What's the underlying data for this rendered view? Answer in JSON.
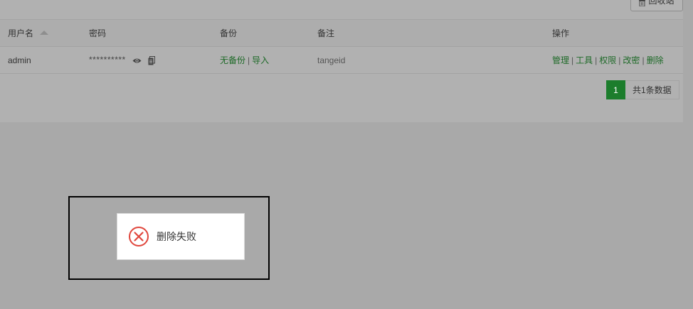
{
  "toolbar": {
    "recycle_label": "回收站"
  },
  "table": {
    "headers": {
      "username": "用户名",
      "password": "密码",
      "backup": "备份",
      "remark": "备注",
      "actions": "操作"
    },
    "rows": [
      {
        "username": "admin",
        "password_mask": "**********",
        "backup_status": "无备份",
        "import_label": "导入",
        "remark": "tangeid",
        "actions": {
          "manage": "管理",
          "tools": "工具",
          "permissions": "权限",
          "change_password": "改密",
          "delete": "删除"
        }
      }
    ]
  },
  "pagination": {
    "current_page": "1",
    "total_text": "共1条数据"
  },
  "toast": {
    "message": "删除失败",
    "icon": "error-circle-x-icon"
  },
  "colors": {
    "accent_green": "#1c7d2c",
    "link_green": "#1e6a28",
    "error_red": "#e0463c",
    "overlay": "#a9a9a9"
  }
}
